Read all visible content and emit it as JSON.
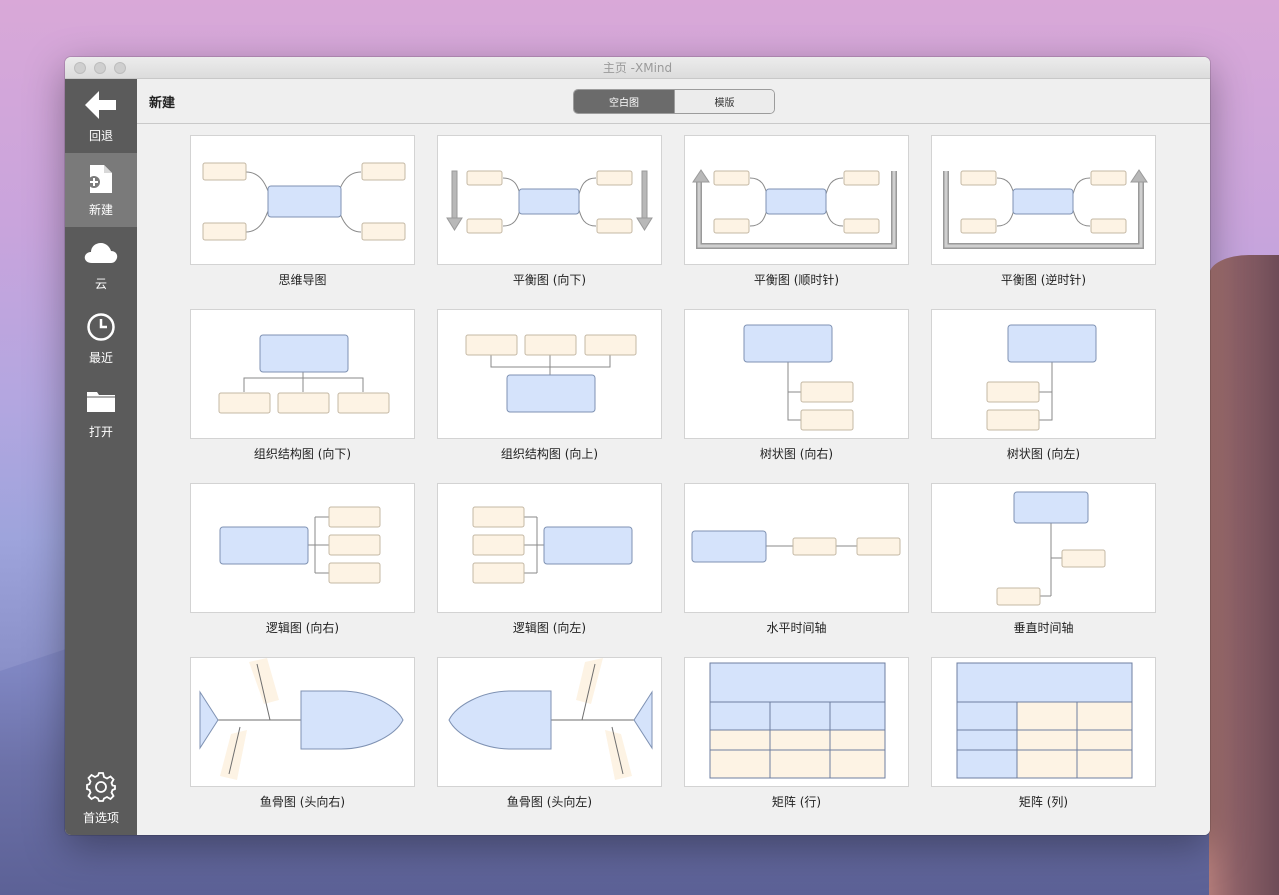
{
  "window": {
    "title": "主页 -XMind"
  },
  "sidebar": {
    "items": [
      {
        "label": "回退",
        "icon": "back-arrow-icon"
      },
      {
        "label": "新建",
        "icon": "new-file-icon"
      },
      {
        "label": "云",
        "icon": "cloud-icon"
      },
      {
        "label": "最近",
        "icon": "clock-icon"
      },
      {
        "label": "打开",
        "icon": "folder-icon"
      }
    ],
    "preferences": {
      "label": "首选项",
      "icon": "gear-icon"
    }
  },
  "toolbar": {
    "title": "新建",
    "tabs": [
      {
        "label": "空白图",
        "selected": true
      },
      {
        "label": "模版",
        "selected": false
      }
    ]
  },
  "templates": [
    {
      "label": "思维导图"
    },
    {
      "label": "平衡图 (向下)"
    },
    {
      "label": "平衡图 (顺时针)"
    },
    {
      "label": "平衡图 (逆时针)"
    },
    {
      "label": "组织结构图 (向下)"
    },
    {
      "label": "组织结构图 (向上)"
    },
    {
      "label": "树状图 (向右)"
    },
    {
      "label": "树状图 (向左)"
    },
    {
      "label": "逻辑图 (向右)"
    },
    {
      "label": "逻辑图 (向左)"
    },
    {
      "label": "水平时间轴"
    },
    {
      "label": "垂直时间轴"
    },
    {
      "label": "鱼骨图 (头向右)"
    },
    {
      "label": "鱼骨图 (头向左)"
    },
    {
      "label": "矩阵 (行)"
    },
    {
      "label": "矩阵 (列)"
    }
  ],
  "colors": {
    "sidebar_bg": "#5b5b5b",
    "sidebar_active": "#7a7a7a",
    "topic_blue": "#d5e3fb",
    "subtopic_cream": "#fdf3e4"
  }
}
